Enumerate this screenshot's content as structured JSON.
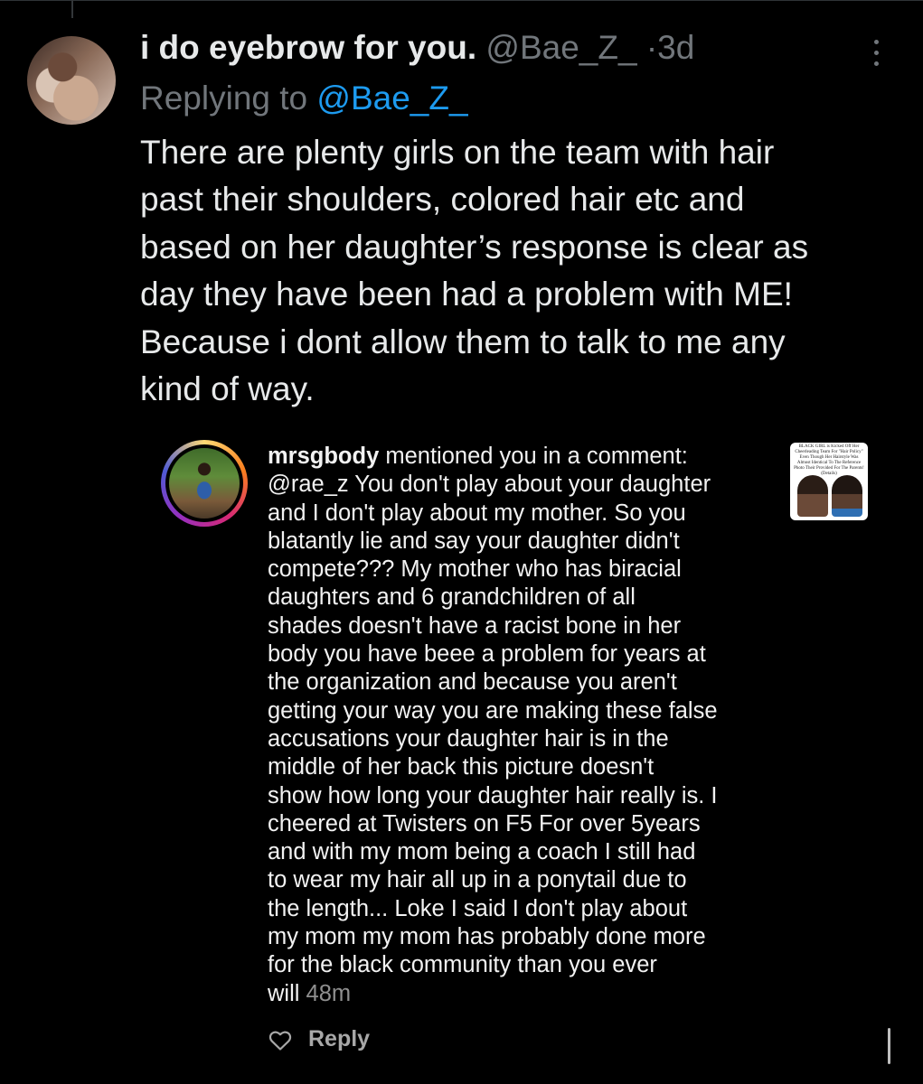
{
  "tweet": {
    "display_name": "i do eyebrow for you.",
    "handle": "@Bae_Z_",
    "separator": "·",
    "time": "3d",
    "replying_prefix": "Replying to",
    "replying_to": "@Bae_Z_",
    "text_lines": [
      "There are plenty girls on the team with hair",
      "past their shoulders, colored hair etc and",
      "based on her daughter’s response is clear as",
      "day they have been had a problem with ME!",
      "Because i dont allow them to talk to me any",
      "kind of way."
    ]
  },
  "instagram_comment": {
    "username": "mrsgbody",
    "action": " mentioned you in a comment:",
    "lines": [
      "@rae_z  You don't play about your daughter",
      "and I don't play about my mother. So you",
      "blatantly lie and say your daughter didn't",
      "compete??? My mother who has biracial",
      "daughters and 6 grandchildren of all",
      "shades doesn't have a racist bone in her",
      "body you have beee a problem for years at",
      "the organization and because you aren't",
      "getting your way you are making these false",
      "accusations your daughter hair is in the",
      "middle of her back this picture doesn't",
      "show how long your daughter hair really is. I",
      "cheered at Twisters on F5  For over 5years",
      "and with my mom being a coach I still had",
      "to wear my hair all up in a ponytail due to",
      "the length... Loke I said I don't play about",
      "my mom my mom has probably done more",
      "for the black community than you ever"
    ],
    "last_line": "will",
    "time": "48m",
    "reply_label": "Reply",
    "thumbnail_caption": "BLACK GIRL is Kicked Off Her Cheerleading Team For \"Hair Policy\" Even Though Her Hairstyle Was Almost Identical To The Reference Photo Their Provided For The Parents! (Details)"
  }
}
